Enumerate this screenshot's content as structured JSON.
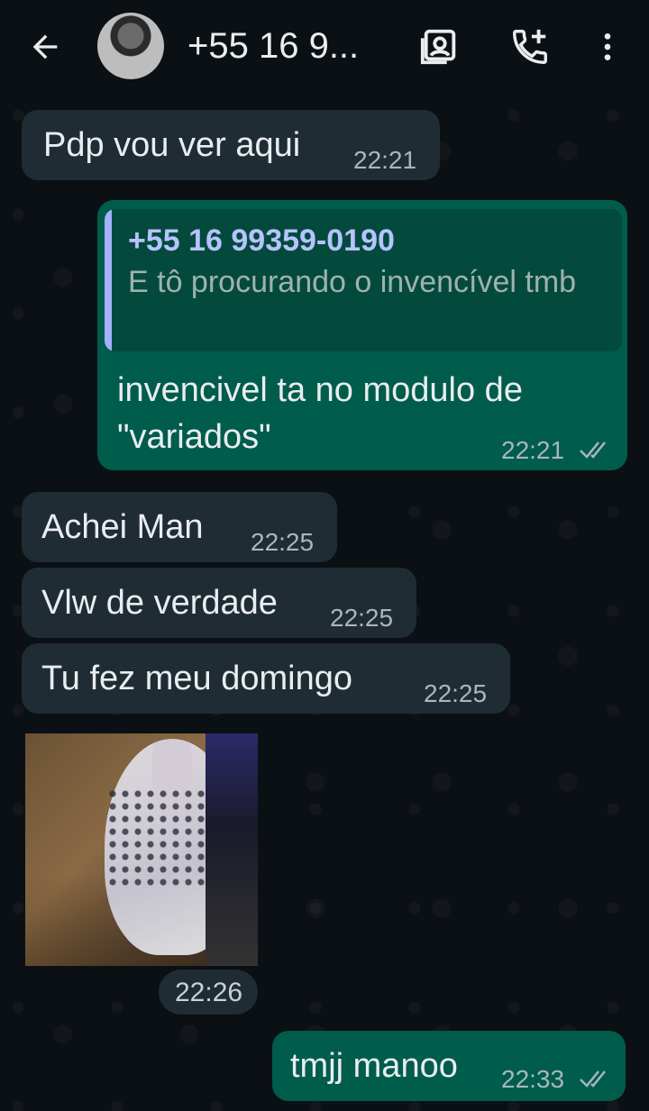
{
  "header": {
    "title": "+55 16 9...",
    "icons": [
      "arrow-back-icon",
      "avatar",
      "video-call-icon",
      "add-call-icon",
      "more-vert-icon"
    ]
  },
  "messages": [
    {
      "dir": "in",
      "text": "Pdp vou ver aqui",
      "time": "22:21"
    },
    {
      "dir": "out",
      "quoted_name": "+55 16 99359-0190",
      "quoted_text": "E tô procurando o invencível tmb",
      "text_line1": "invencivel ta no modulo de",
      "text_line2": "\"variados\"",
      "time": "22:21"
    },
    {
      "dir": "in",
      "text": "Achei Man",
      "time": "22:25"
    },
    {
      "dir": "in",
      "text": "Vlw de verdade",
      "time": "22:25"
    },
    {
      "dir": "in",
      "text": "Tu fez meu domingo",
      "time": "22:25"
    },
    {
      "dir": "in",
      "type": "image",
      "time": "22:26"
    },
    {
      "dir": "out",
      "text": "tmjj manoo",
      "time": "22:33"
    }
  ],
  "colors": {
    "background": "#0b1014",
    "incoming_bubble": "#1f2c34",
    "outgoing_bubble": "#005c4b",
    "quote_bar": "#a5b1ff",
    "read_ticks": "#a9b6bd"
  }
}
